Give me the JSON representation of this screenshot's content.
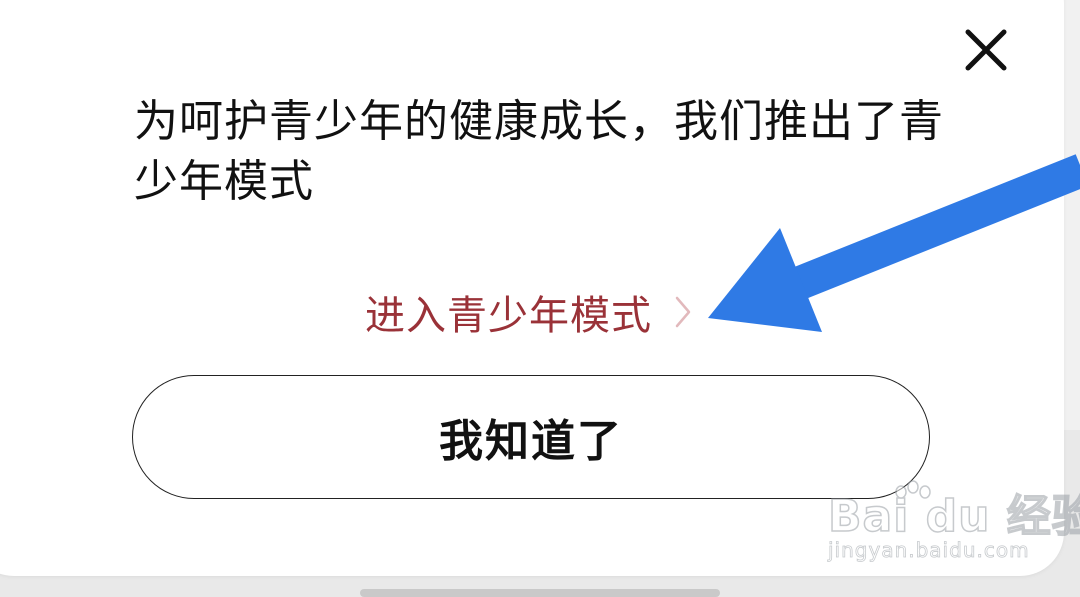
{
  "dialog": {
    "message": "为呵护青少年的健康成长，我们推出了青少年模式",
    "teen_mode_link": "进入青少年模式",
    "acknowledge_button": "我知道了"
  },
  "icons": {
    "close": "close-icon",
    "chevron": "chevron-right-icon",
    "annotation": "arrow-annotation"
  },
  "watermark": {
    "logo": "Bai du 经验",
    "url": "jingyan.baidu.com"
  },
  "colors": {
    "link": "#9a3238",
    "chevron": "#e2b9bc",
    "arrow": "#2f7ae5",
    "text": "#111111"
  }
}
